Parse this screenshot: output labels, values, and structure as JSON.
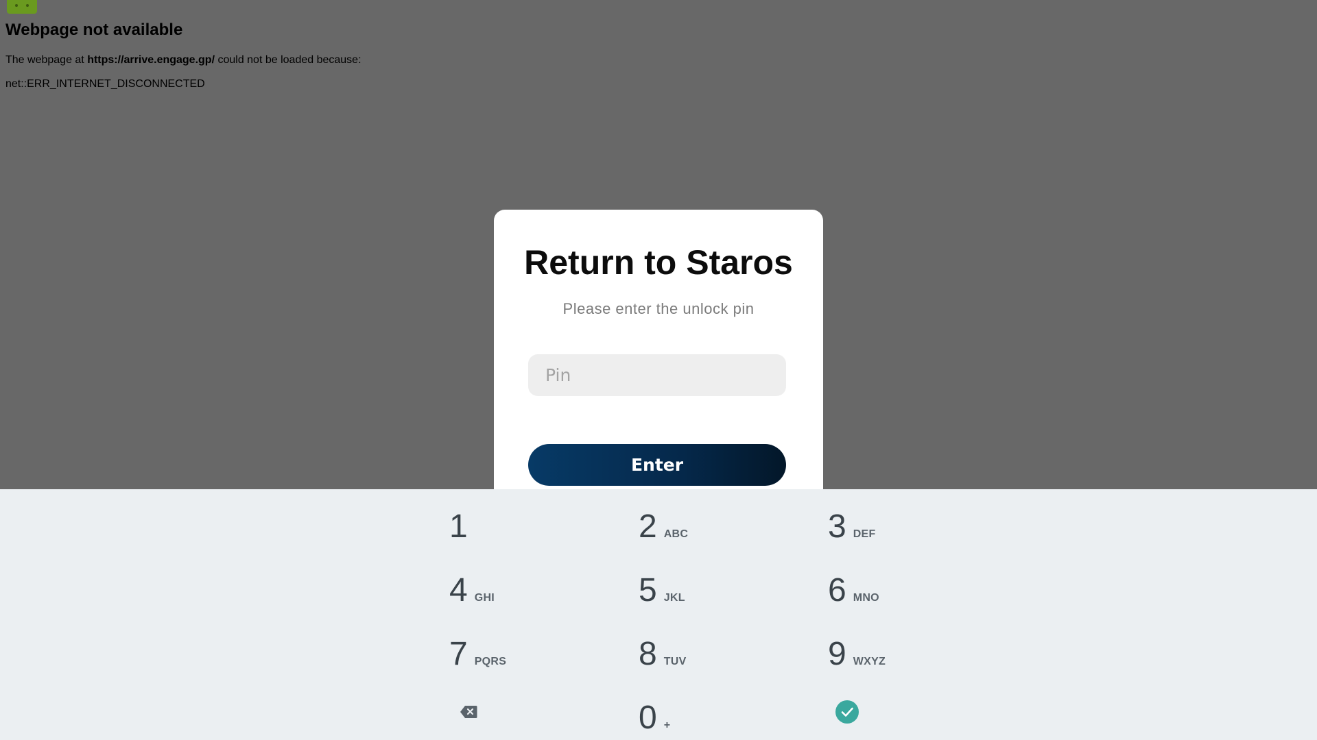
{
  "error_page": {
    "title": "Webpage not available",
    "message_prefix": "The webpage at ",
    "url": "https://arrive.engage.gp/",
    "message_suffix": " could not be loaded because:",
    "error_code": "net::ERR_INTERNET_DISCONNECTED"
  },
  "dialog": {
    "title": "Return to Staros",
    "subtitle": "Please enter the unlock pin",
    "pin_placeholder": "Pin",
    "pin_value": "",
    "enter_label": "Enter"
  },
  "keypad": {
    "keys": [
      {
        "digit": "1",
        "letters": ""
      },
      {
        "digit": "2",
        "letters": "ABC"
      },
      {
        "digit": "3",
        "letters": "DEF"
      },
      {
        "digit": "4",
        "letters": "GHI"
      },
      {
        "digit": "5",
        "letters": "JKL"
      },
      {
        "digit": "6",
        "letters": "MNO"
      },
      {
        "digit": "7",
        "letters": "PQRS"
      },
      {
        "digit": "8",
        "letters": "TUV"
      },
      {
        "digit": "9",
        "letters": "WXYZ"
      },
      {
        "digit": "0",
        "letters": "+"
      }
    ],
    "backspace_icon": "backspace-icon",
    "done_icon": "check-circle-icon",
    "done_color": "#3aa89e"
  },
  "colors": {
    "overlay": "#686868",
    "enter_button": "#05284a",
    "android_logo": "#6a9a1f"
  }
}
